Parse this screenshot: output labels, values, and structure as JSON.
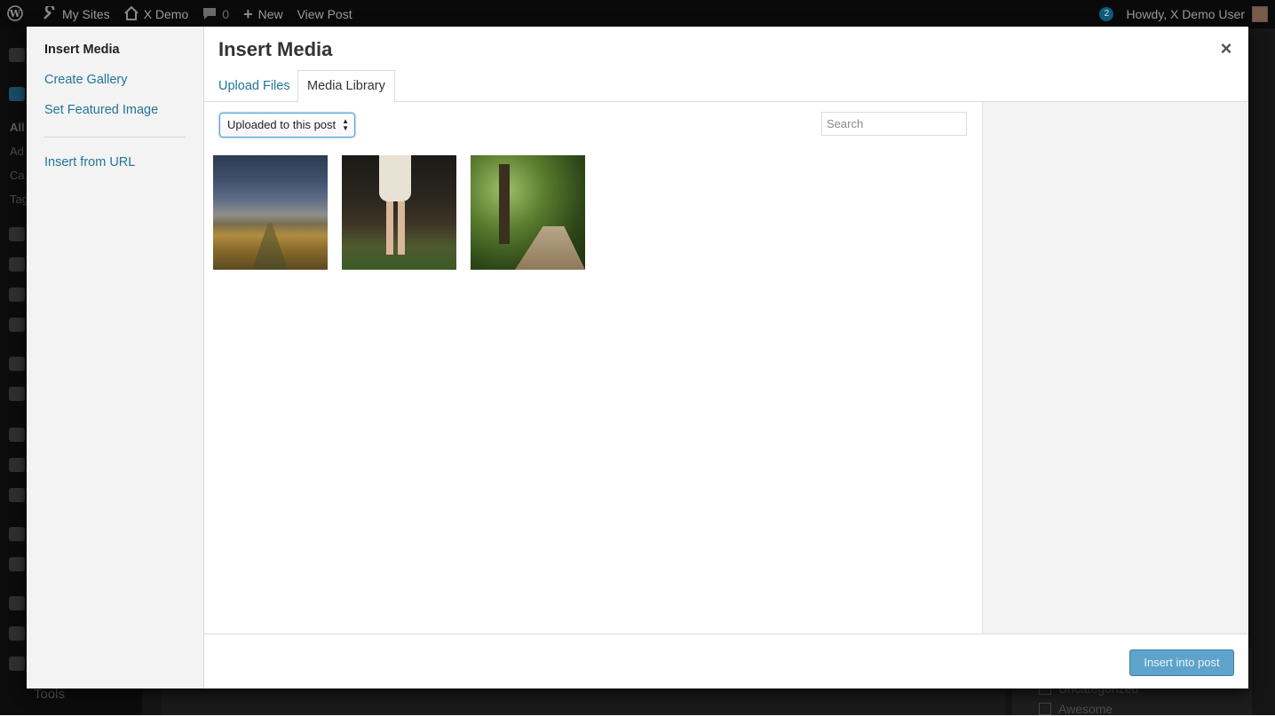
{
  "adminbar": {
    "my_sites": "My Sites",
    "site_name": "X Demo",
    "comments_count": "0",
    "new_label": "New",
    "view_post": "View Post",
    "notifications": "2",
    "howdy": "Howdy, X Demo User"
  },
  "behind": {
    "menu_items": [
      "All",
      "Ad",
      "Ca",
      "Tag"
    ],
    "tools": "Tools",
    "categories": [
      "Uncategorized",
      "Awesome"
    ]
  },
  "modal": {
    "title": "Insert Media",
    "close_icon": "×",
    "menu": {
      "insert_media": "Insert Media",
      "create_gallery": "Create Gallery",
      "set_featured_image": "Set Featured Image",
      "insert_from_url": "Insert from URL"
    },
    "tabs": {
      "upload_files": "Upload Files",
      "media_library": "Media Library"
    },
    "filter": {
      "selected": "Uploaded to this post"
    },
    "search": {
      "placeholder": "Search"
    },
    "toolbar": {
      "insert_label": "Insert into post"
    }
  },
  "colors": {
    "link": "#21759b",
    "button": "#5ea3cc"
  }
}
